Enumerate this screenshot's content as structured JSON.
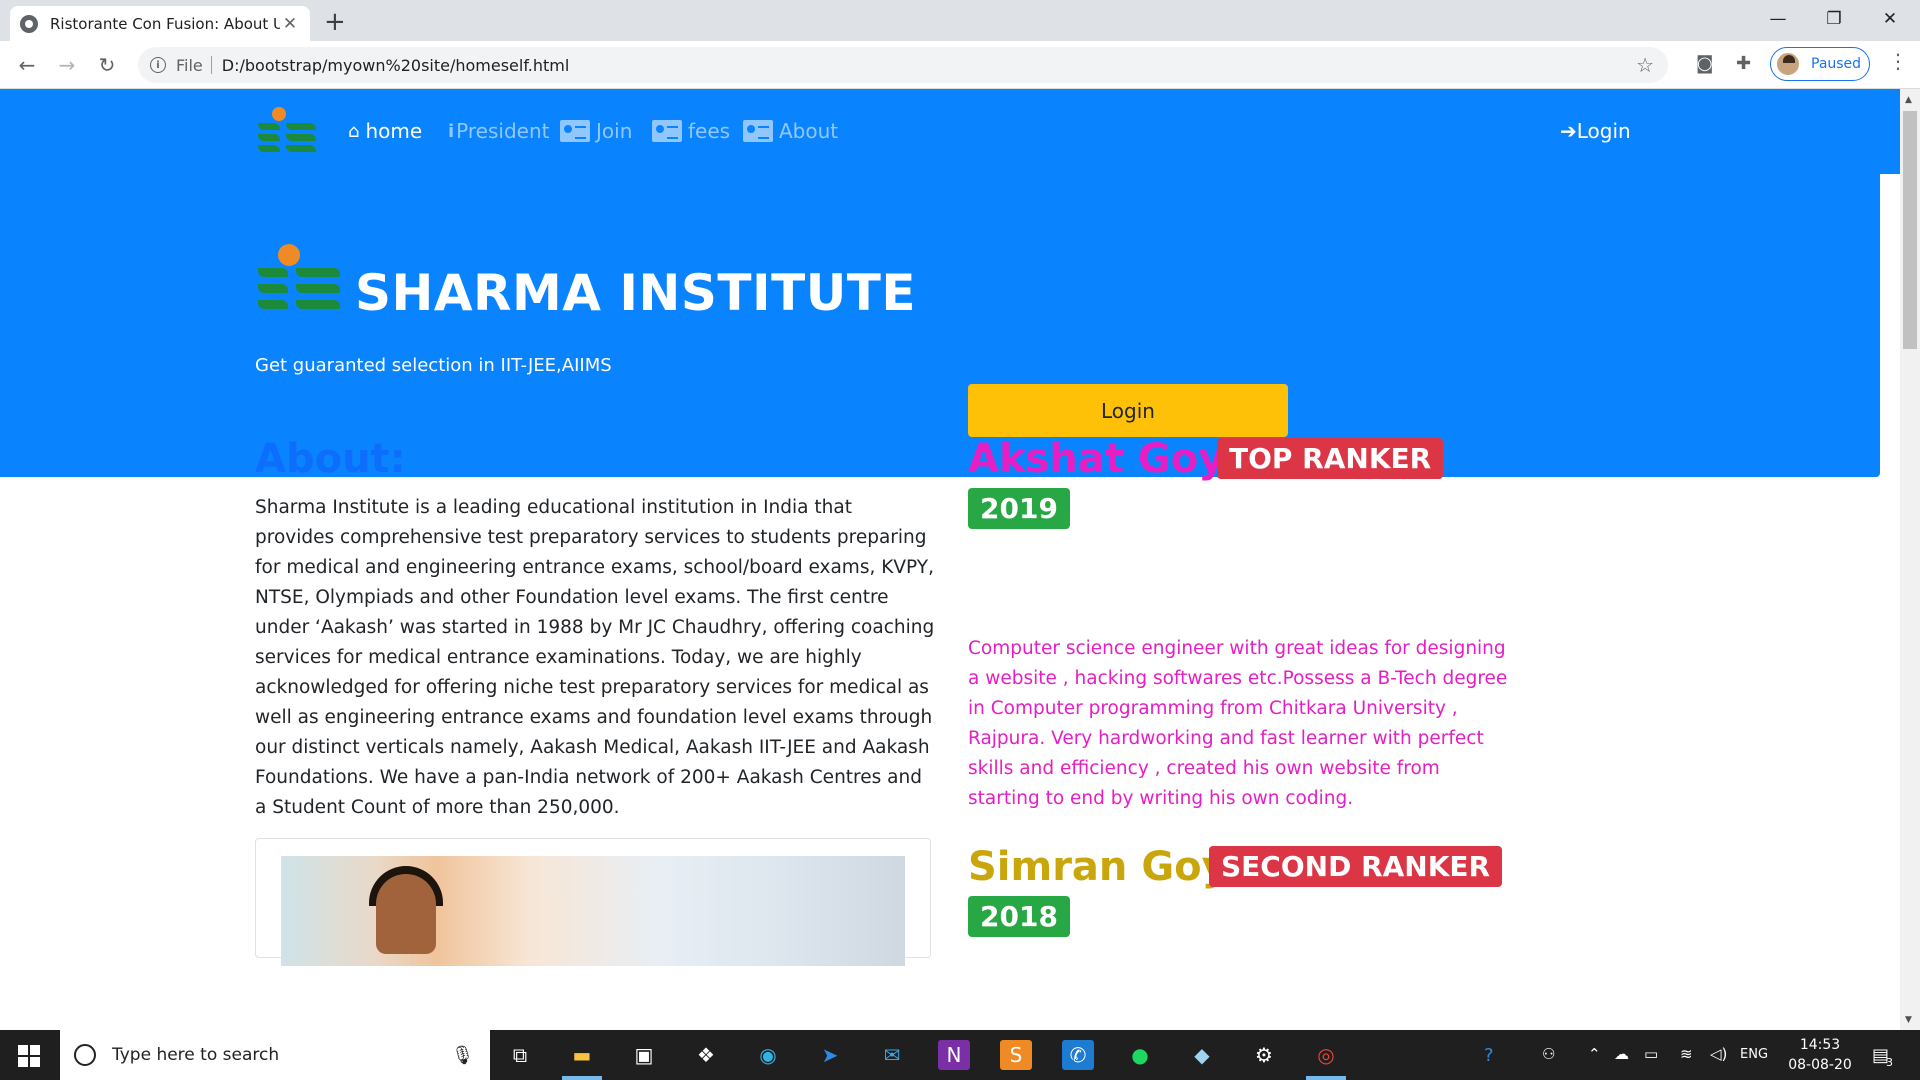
{
  "browser": {
    "tab_title": "Ristorante Con Fusion: About Us",
    "url_prefix": "File",
    "url": "D:/bootstrap/myown%20site/homeself.html",
    "profile_status": "Paused"
  },
  "nav": {
    "items": [
      {
        "label": "home",
        "icon": "house-icon"
      },
      {
        "label": "President",
        "icon": "info-icon"
      },
      {
        "label": "Join",
        "icon": "id-card-icon"
      },
      {
        "label": "fees",
        "icon": "id-card-icon"
      },
      {
        "label": "About",
        "icon": "id-card-icon"
      }
    ],
    "login_label": "Login"
  },
  "hero": {
    "title": "SHARMA INSTITUTE",
    "subtitle": "Get guaranted selection in IIT-JEE,AIIMS",
    "login_button": "Login"
  },
  "about": {
    "heading": "About:",
    "text": "Sharma Institute is a leading educational institution in India that provides comprehensive test preparatory services to students preparing for medical and engineering entrance exams, school/board exams, KVPY, NTSE, Olympiads and other Foundation level exams. The first centre under ‘Aakash’ was started in 1988 by Mr JC Chaudhry, offering coaching services for medical entrance examinations. Today, we are highly acknowledged for offering niche test preparatory services for medical as well as engineering entrance exams and foundation level exams through our distinct verticals namely, Aakash Medical, Aakash IIT-JEE and Aakash Foundations. We have a pan-India network of 200+ Aakash Centres and a Student Count of more than 250,000."
  },
  "rankers": [
    {
      "name": "Akshat Goyal",
      "rank_badge": "TOP RANKER",
      "year": "2019",
      "color": "#e61ec3",
      "description": "Computer science engineer with great ideas for designing a website , hacking softwares etc.Possess a B-Tech degree in Computer programming from Chitkara University , Rajpura. Very hardworking and fast learner with perfect skills and efficiency , created his own website from starting to end by writing his own coding."
    },
    {
      "name": "Simran Goyal",
      "rank_badge": "SECOND RANKER",
      "year": "2018",
      "color": "#c9a70c"
    }
  ],
  "taskbar": {
    "search_placeholder": "Type here to search",
    "language": "ENG",
    "time": "14:53",
    "date": "08-08-20",
    "notification_count": "3"
  },
  "colors": {
    "primary": "#0a83ff",
    "warning": "#ffc107",
    "danger": "#dc3545",
    "success": "#28a745"
  }
}
